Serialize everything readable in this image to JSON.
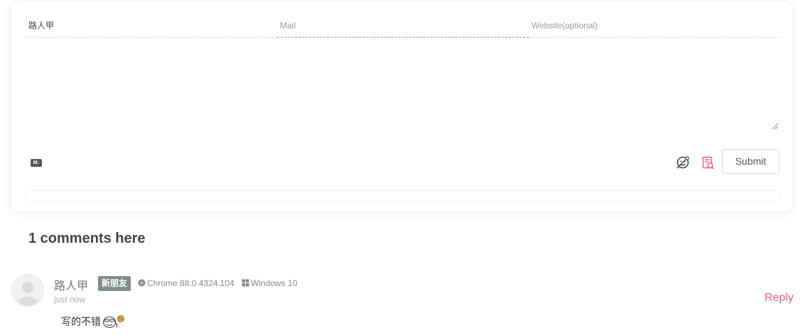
{
  "form": {
    "nick_value": "路人甲",
    "mail_placeholder": "Mail",
    "website_placeholder": "Website(optional)",
    "comment_value": "",
    "markdown_icon": "markdown-icon",
    "emoji_icon": "emoji-icon",
    "preview_icon": "preview-icon",
    "submit_label": "Submit"
  },
  "comments": {
    "count_number": "1",
    "count_suffix": " comments here",
    "items": [
      {
        "author": "路人甲",
        "badge": "新朋友",
        "browser": "Chrome 88.0.4324.104",
        "os": "Windows 10",
        "time": "just now",
        "text": "写的不错",
        "reply_label": "Reply"
      }
    ]
  },
  "colors": {
    "accent": "#ec5f76",
    "badge_bg": "#7f8c8d",
    "mail_underline": "#e07a8c"
  }
}
